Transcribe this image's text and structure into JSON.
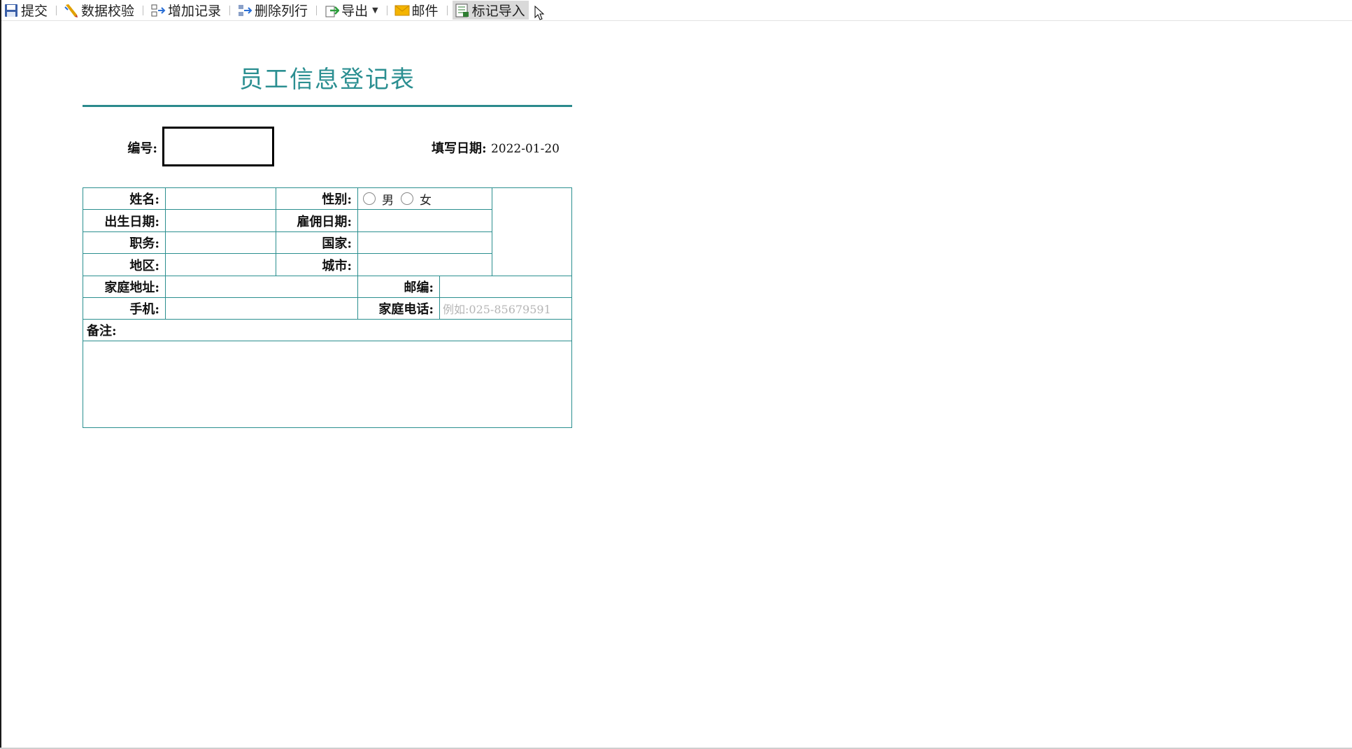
{
  "toolbar": {
    "items": [
      {
        "label": "提交",
        "icon": "floppy-save-icon"
      },
      {
        "label": "数据校验",
        "icon": "pencil-check-icon"
      },
      {
        "label": "增加记录",
        "icon": "insert-row-icon"
      },
      {
        "label": "删除列行",
        "icon": "delete-row-icon"
      },
      {
        "label": "导出",
        "icon": "export-arrow-icon"
      },
      {
        "label": "邮件",
        "icon": "envelope-icon"
      },
      {
        "label": "标记导入",
        "icon": "import-sheet-icon"
      }
    ]
  },
  "form": {
    "title": "员工信息登记表",
    "id_label": "编号:",
    "date_label": "填写日期:",
    "date_value": "2022-01-20",
    "fields": {
      "name": "姓名:",
      "gender": "性别:",
      "male": "男",
      "female": "女",
      "birth_date": "出生日期:",
      "hire_date": "雇佣日期:",
      "position": "职务:",
      "country": "国家:",
      "region": "地区:",
      "city": "城市:",
      "address": "家庭地址:",
      "postcode": "邮编:",
      "mobile": "手机:",
      "home_phone": "家庭电话:",
      "home_phone_placeholder": "例如:025-85679591",
      "remarks": "备注:"
    }
  },
  "colors": {
    "title": "#2b8f91",
    "rule": "#2b8a8c",
    "grid": "#2b8f8f",
    "active_tool": "#d9d9d9"
  }
}
